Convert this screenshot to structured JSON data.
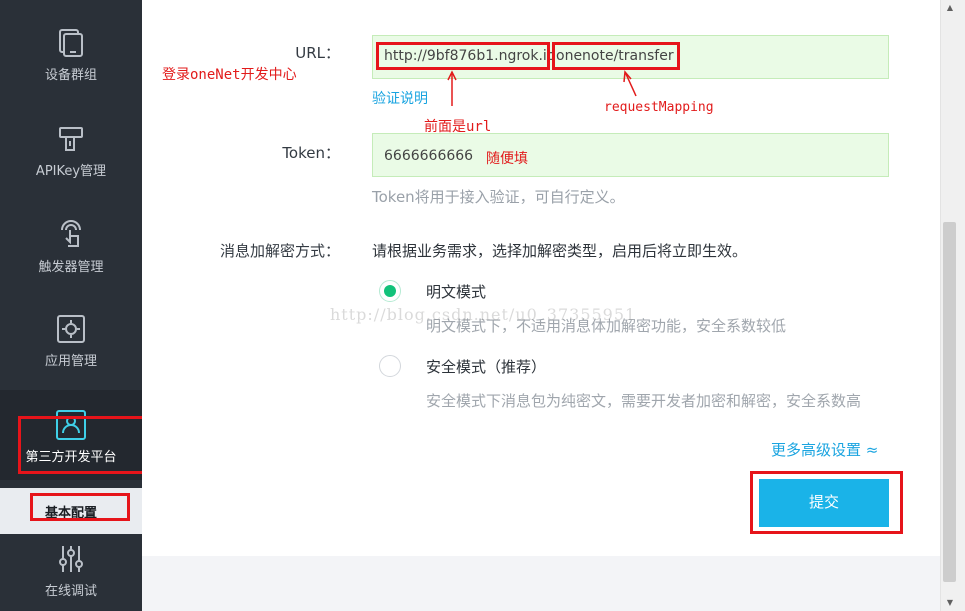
{
  "sidebar": {
    "items": [
      {
        "label": "设备群组",
        "icon": "device-group-icon"
      },
      {
        "label": "APIKey管理",
        "icon": "key-icon"
      },
      {
        "label": "触发器管理",
        "icon": "touch-icon"
      },
      {
        "label": "应用管理",
        "icon": "app-gear-icon"
      },
      {
        "label": "第三方开发平台",
        "icon": "third-party-icon"
      },
      {
        "label": "在线调试",
        "icon": "sliders-icon"
      }
    ],
    "sub_item": "基本配置"
  },
  "form": {
    "url_label": "URL：",
    "url_part1": "http://9bf876b1.ngrok.io",
    "url_part2": "onenote/transfer",
    "verify_link": "验证说明",
    "token_label": "Token：",
    "token_value": "6666666666",
    "token_help": "Token将用于接入验证，可自行定义。",
    "encrypt_label": "消息加解密方式：",
    "encrypt_desc": "请根据业务需求，选择加解密类型，启用后将立即生效。",
    "options": [
      {
        "title": "明文模式",
        "desc": "明文模式下，不适用消息体加解密功能，安全系数较低",
        "selected": true
      },
      {
        "title": "安全模式（推荐）",
        "desc": "安全模式下消息包为纯密文，需要开发者加密和解密，安全系数高",
        "selected": false
      }
    ],
    "more_settings": "更多高级设置 ≈",
    "submit_label": "提交"
  },
  "annotations": {
    "login_note": "登录oneNet开发中心",
    "front_note": "前面是url",
    "mapping_note": "requestMapping",
    "token_note": "随便填"
  },
  "watermark": "http://blog.csdn.net/u0_37355951",
  "colors": {
    "accent": "#1ab3e8",
    "annotation": "#e21b1b",
    "radio_on": "#12c27a",
    "field_bg": "#eafbe6"
  }
}
